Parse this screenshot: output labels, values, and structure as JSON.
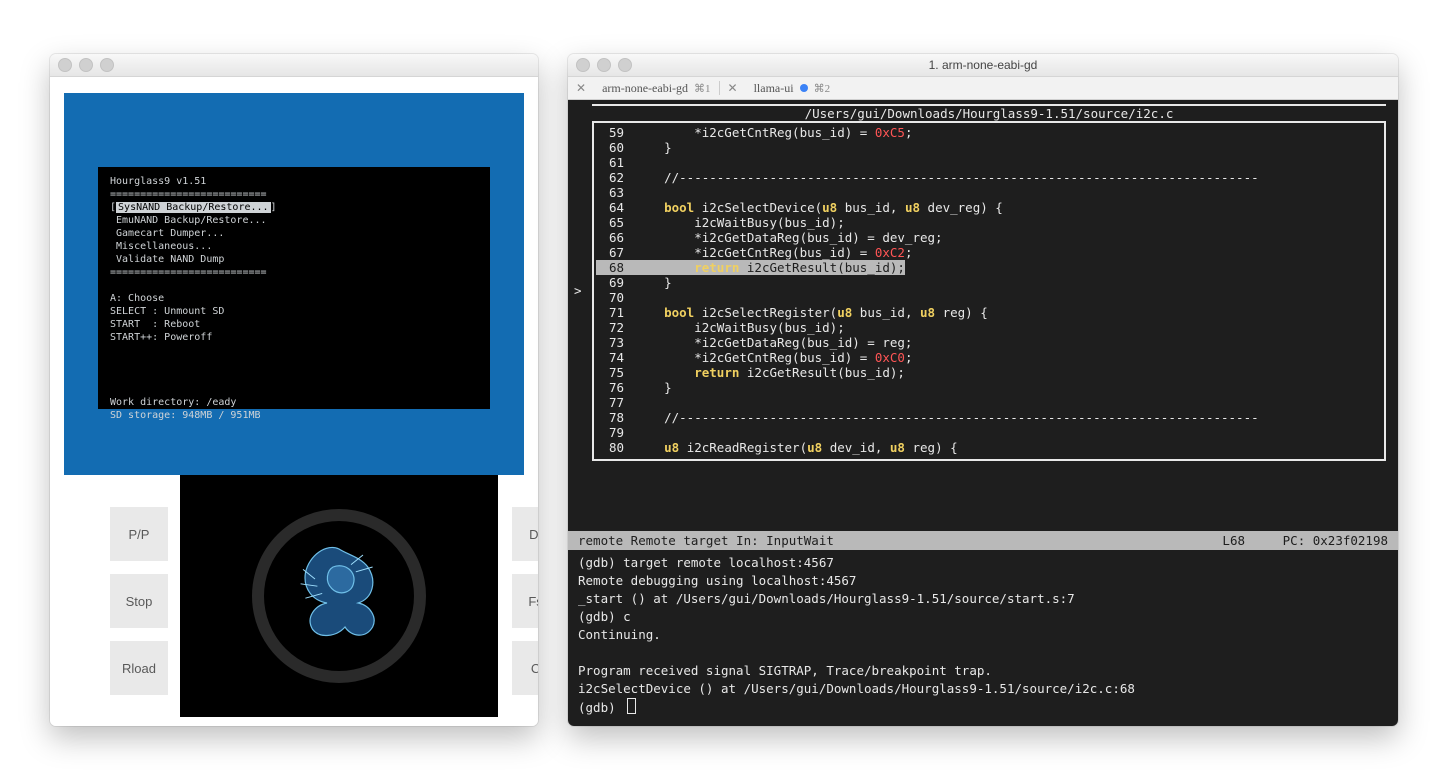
{
  "emulator": {
    "console": {
      "title": "Hourglass9 v1.51",
      "rule": "==========================",
      "menu": [
        "SysNAND Backup/Restore...",
        "EmuNAND Backup/Restore...",
        "Gamecart Dumper...",
        "Miscellaneous...",
        "Validate NAND Dump"
      ],
      "selected_index": 0,
      "hints": [
        "A: Choose",
        "SELECT : Unmount SD",
        "START  : Reboot",
        "START++: Poweroff"
      ],
      "workdir": "Work directory: /eady",
      "sd": "SD storage: 948MB / 951MB"
    },
    "buttons_left": [
      "P/P",
      "Stop",
      "Rload"
    ],
    "buttons_right": [
      "Dbg",
      "Fscr",
      "Cfg"
    ]
  },
  "terminal": {
    "title": "1. arm-none-eabi-gd",
    "tabs": [
      {
        "label": "arm-none-eabi-gd",
        "shortcut": "⌘1",
        "dirty": false
      },
      {
        "label": "llama-ui",
        "shortcut": "⌘2",
        "dirty": true
      }
    ],
    "source_file": "/Users/gui/Downloads/Hourglass9-1.51/source/i2c.c",
    "lines_start": 59,
    "current_line": 68,
    "code": [
      "        *i2cGetCntReg(bus_id) = 0xC5;",
      "    }",
      "",
      "    //-----------------------------------------------------------------------------",
      "",
      "    bool i2cSelectDevice(u8 bus_id, u8 dev_reg) {",
      "        i2cWaitBusy(bus_id);",
      "        *i2cGetDataReg(bus_id) = dev_reg;",
      "        *i2cGetCntReg(bus_id) = 0xC2;",
      "        return i2cGetResult(bus_id);",
      "    }",
      "",
      "    bool i2cSelectRegister(u8 bus_id, u8 reg) {",
      "        i2cWaitBusy(bus_id);",
      "        *i2cGetDataReg(bus_id) = reg;",
      "        *i2cGetCntReg(bus_id) = 0xC0;",
      "        return i2cGetResult(bus_id);",
      "    }",
      "",
      "    //-----------------------------------------------------------------------------",
      "",
      "    u8 i2cReadRegister(u8 dev_id, u8 reg) {"
    ],
    "status_left": "remote Remote target In: InputWait",
    "status_right_line": "L68",
    "status_right_pc": "PC: 0x23f02198",
    "console_lines": [
      "(gdb) target remote localhost:4567",
      "Remote debugging using localhost:4567",
      "_start () at /Users/gui/Downloads/Hourglass9-1.51/source/start.s:7",
      "(gdb) c",
      "Continuing.",
      "",
      "Program received signal SIGTRAP, Trace/breakpoint trap.",
      "i2cSelectDevice () at /Users/gui/Downloads/Hourglass9-1.51/source/i2c.c:68"
    ],
    "prompt": "(gdb) "
  }
}
